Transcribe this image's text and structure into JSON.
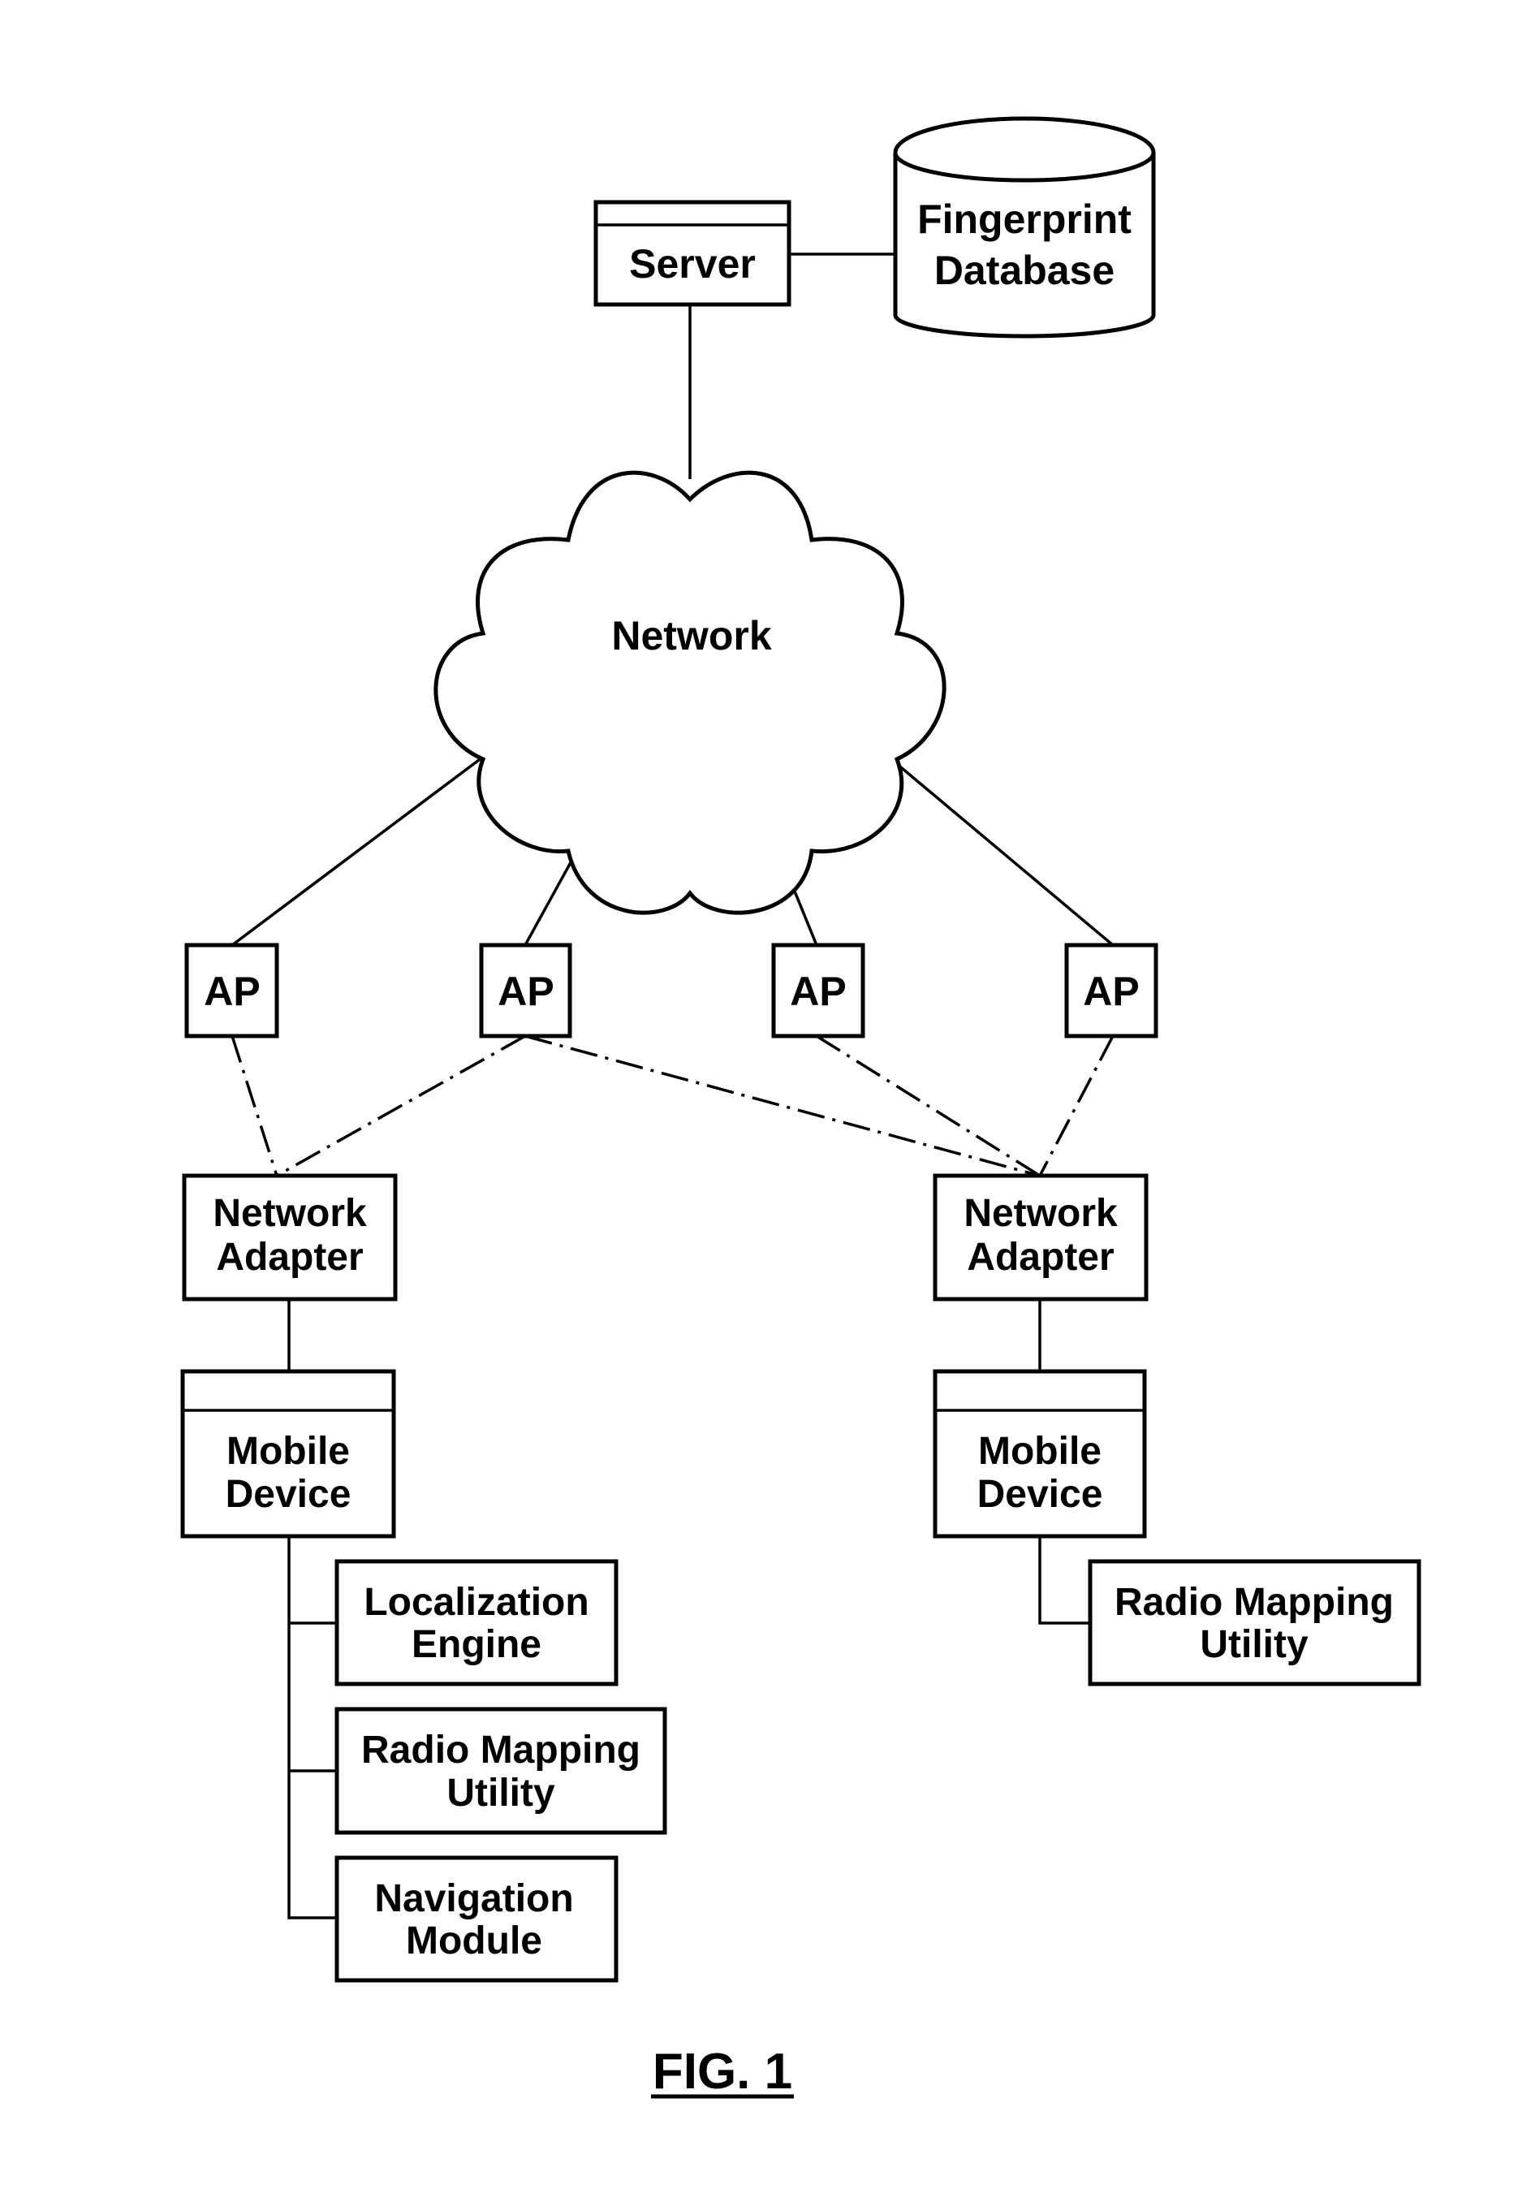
{
  "figure": {
    "caption": "FIG. 1",
    "line_color": "#000000",
    "background": "#ffffff"
  },
  "nodes": {
    "server": {
      "label": "Server"
    },
    "database": {
      "line1": "Fingerprint",
      "line2": "Database"
    },
    "network": {
      "label": "Network"
    },
    "access_points": [
      {
        "label": "AP"
      },
      {
        "label": "AP"
      },
      {
        "label": "AP"
      },
      {
        "label": "AP"
      }
    ],
    "left_adapter": {
      "line1": "Network",
      "line2": "Adapter"
    },
    "right_adapter": {
      "line1": "Network",
      "line2": "Adapter"
    },
    "left_device": {
      "line1": "Mobile",
      "line2": "Device"
    },
    "right_device": {
      "line1": "Mobile",
      "line2": "Device"
    },
    "left_modules": [
      {
        "line1": "Localization",
        "line2": "Engine"
      },
      {
        "line1": "Radio Mapping",
        "line2": "Utility"
      },
      {
        "line1": "Navigation",
        "line2": "Module"
      }
    ],
    "right_modules": [
      {
        "line1": "Radio Mapping",
        "line2": "Utility"
      }
    ]
  },
  "connections": [
    {
      "from": "Server",
      "to": "Fingerprint Database",
      "style": "solid"
    },
    {
      "from": "Server",
      "to": "Network",
      "style": "solid"
    },
    {
      "from": "Network",
      "to": "AP 1",
      "style": "solid"
    },
    {
      "from": "Network",
      "to": "AP 2",
      "style": "solid"
    },
    {
      "from": "Network",
      "to": "AP 3",
      "style": "solid"
    },
    {
      "from": "Network",
      "to": "AP 4",
      "style": "solid"
    },
    {
      "from": "AP 1",
      "to": "Left Network Adapter",
      "style": "dash-dot"
    },
    {
      "from": "AP 2",
      "to": "Left Network Adapter",
      "style": "dash-dot"
    },
    {
      "from": "AP 2",
      "to": "Right Network Adapter",
      "style": "dash-dot"
    },
    {
      "from": "AP 3",
      "to": "Right Network Adapter",
      "style": "dash-dot"
    },
    {
      "from": "AP 4",
      "to": "Right Network Adapter",
      "style": "dash-dot"
    },
    {
      "from": "Left Network Adapter",
      "to": "Left Mobile Device",
      "style": "solid"
    },
    {
      "from": "Right Network Adapter",
      "to": "Right Mobile Device",
      "style": "solid"
    },
    {
      "from": "Left Mobile Device",
      "to": "Localization Engine",
      "style": "solid"
    },
    {
      "from": "Left Mobile Device",
      "to": "Radio Mapping Utility",
      "style": "solid"
    },
    {
      "from": "Left Mobile Device",
      "to": "Navigation Module",
      "style": "solid"
    },
    {
      "from": "Right Mobile Device",
      "to": "Radio Mapping Utility",
      "style": "solid"
    }
  ]
}
